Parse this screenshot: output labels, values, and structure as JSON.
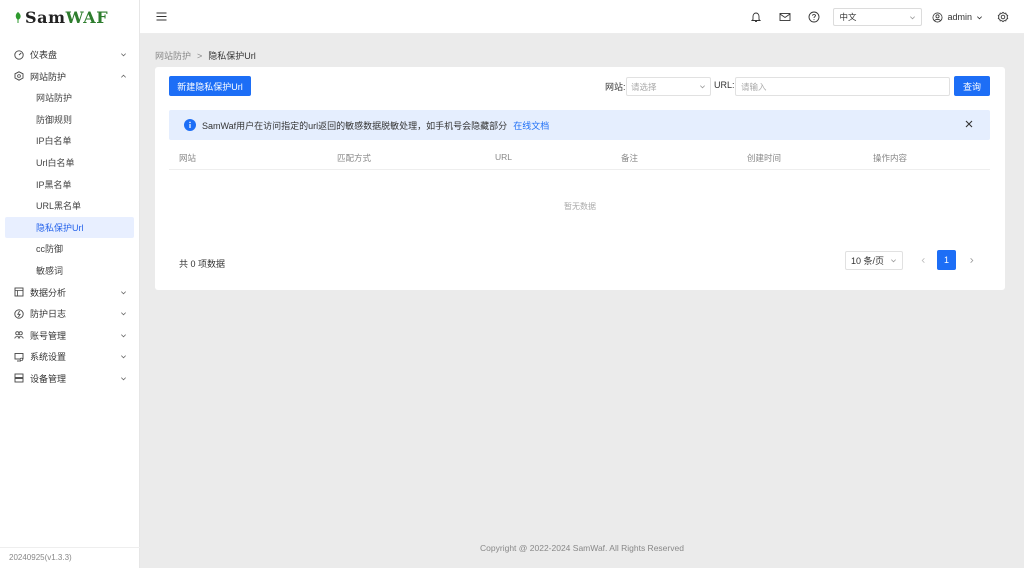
{
  "brand": {
    "part1": "Sam",
    "part2": "WAF"
  },
  "sidebar": {
    "items": [
      {
        "label": "仪表盘",
        "icon": "dashboard-icon"
      },
      {
        "label": "网站防护",
        "icon": "shield-icon"
      }
    ],
    "sub_items": [
      {
        "label": "网站防护"
      },
      {
        "label": "防御规则"
      },
      {
        "label": "IP白名单"
      },
      {
        "label": "Url白名单"
      },
      {
        "label": "IP黑名单"
      },
      {
        "label": "URL黑名单"
      },
      {
        "label": "隐私保护Url"
      },
      {
        "label": "cc防御"
      },
      {
        "label": "敏感词"
      }
    ],
    "bottom_items": [
      {
        "label": "数据分析",
        "icon": "analytics-icon"
      },
      {
        "label": "防护日志",
        "icon": "log-icon"
      },
      {
        "label": "账号管理",
        "icon": "users-icon"
      },
      {
        "label": "系统设置",
        "icon": "settings-icon"
      },
      {
        "label": "设备管理",
        "icon": "device-icon"
      }
    ],
    "version": "20240925(v1.3.3)"
  },
  "header": {
    "language": "中文",
    "user": "admin"
  },
  "breadcrumb": {
    "parent": "网站防护",
    "separator": ">",
    "current": "隐私保护Url"
  },
  "toolbar": {
    "new_label": "新建隐私保护Url",
    "site_label": "网站:",
    "site_placeholder": "请选择",
    "url_label": "URL:",
    "url_placeholder": "请输入",
    "query_label": "查询"
  },
  "alert": {
    "text": "SamWaf用户在访问指定的url返回的敏感数据脱敏处理，如手机号会隐藏部分",
    "link": "在线文档"
  },
  "table": {
    "columns": [
      "网站",
      "匹配方式",
      "URL",
      "备注",
      "创建时间",
      "操作内容"
    ],
    "empty_text": "暂无数据"
  },
  "pagination": {
    "total_text": "共 0 项数据",
    "page_size": "10 条/页",
    "current_page": "1"
  },
  "footer": {
    "text": "Copyright @ 2022-2024 SamWaf. All Rights Reserved"
  },
  "colors": {
    "primary": "#1d6ef6",
    "active_bg": "#e8efff",
    "alert_bg": "#e5eefe",
    "brand_green": "#2e7d2e"
  }
}
